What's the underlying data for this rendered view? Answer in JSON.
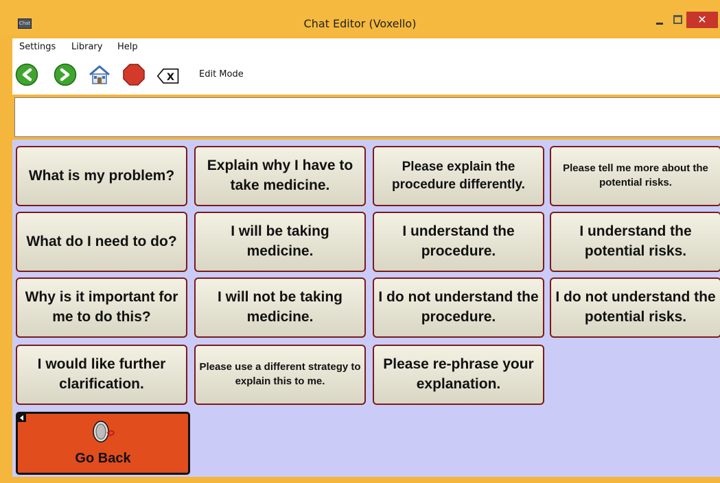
{
  "window": {
    "title": "Chat Editor (Voxello)",
    "app_icon_text": "Chat",
    "close_glyph": "✕"
  },
  "menu": {
    "items": [
      "Settings",
      "Library",
      "Help"
    ]
  },
  "toolbar": {
    "mode_label": "Edit Mode",
    "icons": [
      "back-arrow-icon",
      "forward-arrow-icon",
      "home-icon",
      "stop-icon",
      "clear-icon"
    ],
    "clear_glyph": "X"
  },
  "message_box": {
    "value": ""
  },
  "grid": {
    "rows": [
      [
        "What is my problem?",
        "Explain why I have to take medicine.",
        "Please explain the procedure differently.",
        "Please tell me more about the potential risks."
      ],
      [
        "What do I need to do?",
        "I will be taking medicine.",
        "I understand the procedure.",
        "I understand the potential risks."
      ],
      [
        "Why is it important for me to do this?",
        "I will not be taking medicine.",
        "I do not understand the procedure.",
        "I do not understand the potential risks."
      ],
      [
        "I would like further clarification.",
        "Please use a different strategy to explain this to me.",
        "Please re-phrase your explanation."
      ]
    ],
    "go_back": {
      "label": "Go Back",
      "icon": "speaker-icon"
    }
  },
  "colors": {
    "title_bar": "#f5b93f",
    "grid_background": "#cbcbf7",
    "tile_border": "#7a1a1a",
    "go_back_fill": "#e14d1d",
    "close_button": "#c7352b"
  }
}
